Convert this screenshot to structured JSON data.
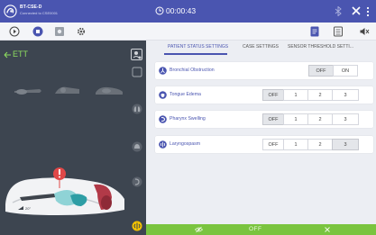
{
  "titlebar": {
    "device_name": "BT-CSE-D",
    "connection_status": "Connected to CSE0001",
    "timer": "00:00:43"
  },
  "toolbar": {
    "icons": [
      "play-icon",
      "stop-icon",
      "record-icon",
      "settings-gear-icon",
      "document-icon",
      "checklist-icon",
      "mute-icon"
    ]
  },
  "scenario": {
    "title": "ETT"
  },
  "tabs": [
    {
      "label": "PATIENT STATUS SETTINGS",
      "active": true
    },
    {
      "label": "CASE SETTINGS",
      "active": false
    },
    {
      "label": "SENSOR THRESHOLD SETTI...",
      "active": false
    }
  ],
  "settings": [
    {
      "label": "Bronchial Obstruction",
      "options": [
        "OFF",
        "ON"
      ],
      "selected": "OFF"
    },
    {
      "label": "Tongue Edema",
      "options": [
        "OFF",
        "1",
        "2",
        "3"
      ],
      "selected": "OFF"
    },
    {
      "label": "Pharynx Swelling",
      "options": [
        "OFF",
        "1",
        "2",
        "3"
      ],
      "selected": "OFF"
    },
    {
      "label": "Laryngospasm",
      "options": [
        "OFF",
        "1",
        "2",
        "3"
      ],
      "selected": "3"
    }
  ],
  "bottombar": {
    "status": "OFF"
  },
  "colors": {
    "accent": "#4a55b0",
    "green": "#7ac43f",
    "panel_dark": "#3d4550"
  }
}
